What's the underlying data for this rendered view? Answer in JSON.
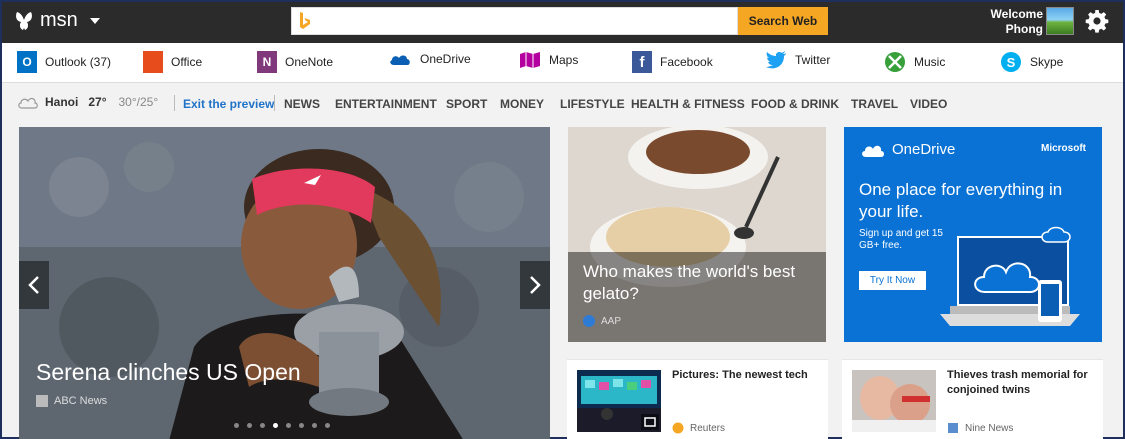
{
  "header": {
    "logo_text": "msn",
    "search_placeholder": "",
    "search_button": "Search Web",
    "welcome_line1": "Welcome",
    "welcome_line2": "Phong"
  },
  "apps": [
    {
      "label": "Outlook (37)",
      "color": "#0072c6"
    },
    {
      "label": "Office",
      "color": "#e74c1c"
    },
    {
      "label": "OneNote",
      "color": "#80397b"
    },
    {
      "label": "OneDrive",
      "color": "#0a5fb4"
    },
    {
      "label": "Maps",
      "color": "#b4009e"
    },
    {
      "label": "Facebook",
      "color": "#3b5998"
    },
    {
      "label": "Twitter",
      "color": "#1da1f2"
    },
    {
      "label": "Music",
      "color": "#37a03a"
    },
    {
      "label": "Skype",
      "color": "#00aff0"
    }
  ],
  "nav": {
    "city": "Hanoi",
    "temp": "27°",
    "range": "30°/25°",
    "exit_preview": "Exit the preview",
    "categories": [
      "NEWS",
      "ENTERTAINMENT",
      "SPORT",
      "MONEY",
      "LIFESTYLE",
      "HEALTH & FITNESS",
      "FOOD & DRINK",
      "TRAVEL",
      "VIDEO"
    ]
  },
  "hero": {
    "title": "Serena clinches US Open",
    "source": "ABC News",
    "active_dot": 3,
    "dot_count": 8
  },
  "gelato": {
    "title": "Who makes the world's best gelato?",
    "source": "AAP"
  },
  "ad": {
    "brand": "OneDrive",
    "vendor": "Microsoft",
    "headline": "One place for everything in your life.",
    "sub": "Sign up and get 15 GB+ free.",
    "cta": "Try It Now"
  },
  "cards": [
    {
      "title": "Pictures: The newest tech",
      "source": "Reuters"
    },
    {
      "title": "Thieves trash memorial for conjoined twins",
      "source": "Nine News"
    }
  ],
  "colors": {
    "topbar": "#2b2b2b",
    "search_button": "#f5a623",
    "link_blue": "#1f73c8",
    "ad_blue": "#0a72d4"
  }
}
